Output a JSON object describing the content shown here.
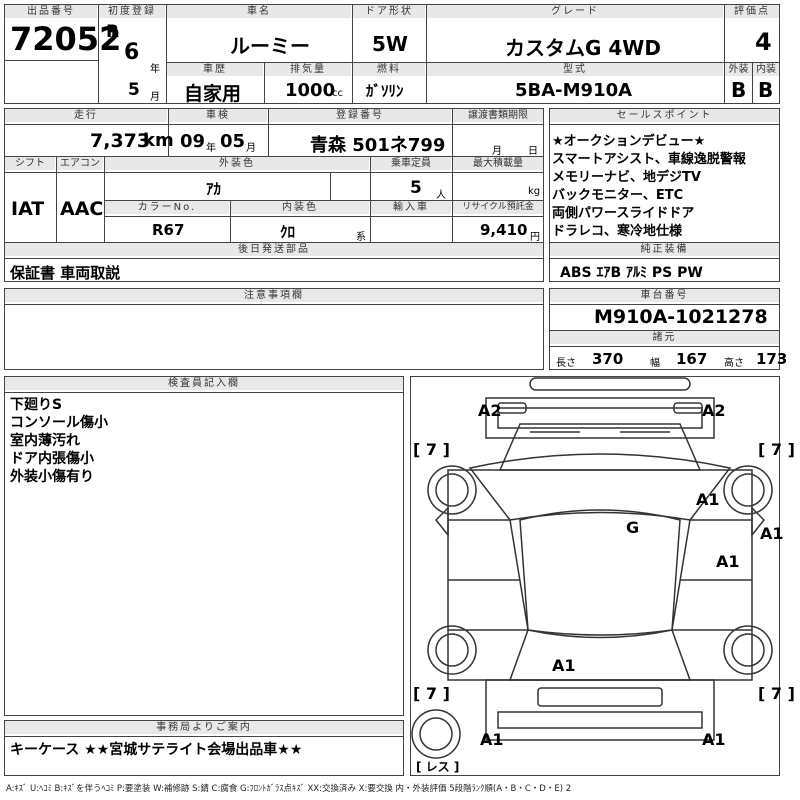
{
  "lot": {
    "label": "出品番号",
    "value": "72052"
  },
  "reg_year": {
    "label": "初度登録",
    "era": "R",
    "year": "6",
    "year_unit": "年",
    "month": "5",
    "month_unit": "月"
  },
  "car_name": {
    "label": "車名",
    "value": "ルーミー"
  },
  "door": {
    "label": "ドア形状",
    "value": "5W"
  },
  "grade": {
    "label": "グレード",
    "value": "カスタムG 4WD"
  },
  "score": {
    "label": "評価点",
    "value": "4",
    "ext_label": "外装",
    "int_label": "内装",
    "ext_value": "B",
    "int_value": "B"
  },
  "history": {
    "label": "車歴",
    "value": "自家用"
  },
  "displacement": {
    "label": "排気量",
    "value": "1000",
    "unit": "cc"
  },
  "fuel": {
    "label": "燃料",
    "value": "ｶﾞｿﾘﾝ"
  },
  "model": {
    "label": "型式",
    "value": "5BA-M910A"
  },
  "mileage": {
    "label": "走行",
    "value": "7,373",
    "unit": "km"
  },
  "inspection": {
    "label": "車検",
    "year": "09",
    "year_unit": "年",
    "month": "05",
    "month_unit": "月"
  },
  "plate": {
    "label": "登録番号",
    "value": "青森 501ネ799"
  },
  "transfer": {
    "label": "譲渡書類期限",
    "month_unit": "月",
    "day_unit": "日"
  },
  "shift": {
    "label": "シフト",
    "value": "IAT"
  },
  "ac": {
    "label": "エアコン",
    "value": "AAC"
  },
  "exterior_color": {
    "label": "外装色",
    "value": "ｱｶ"
  },
  "capacity": {
    "label": "乗車定員",
    "value": "5",
    "unit": "人"
  },
  "max_load": {
    "label": "最大積載量",
    "unit": "kg"
  },
  "color_no": {
    "label": "カラーNo.",
    "value": "R67"
  },
  "interior_color": {
    "label": "内装色",
    "value": "ｸﾛ",
    "unit": "系"
  },
  "import": {
    "label": "輸入車"
  },
  "recycle": {
    "label": "リサイクル預託金",
    "value": "9,410",
    "unit": "円"
  },
  "sales_points": {
    "label": "セールスポイント",
    "items": [
      "★オークションデビュー★",
      "スマートアシスト、車線逸脱警報",
      "メモリーナビ、地デジTV",
      "バックモニター、ETC",
      "両側パワースライドドア",
      "ドラレコ、寒冷地仕様"
    ]
  },
  "later_parts": {
    "label": "後日発送部品",
    "value": "保証書 車両取説"
  },
  "equipment": {
    "label": "純正装備",
    "value": "ABS ｴｱB ｱﾙﾐ PS PW"
  },
  "notes": {
    "label": "注意事項欄"
  },
  "chassis": {
    "label": "車台番号",
    "value": "M910A-1021278"
  },
  "dims": {
    "label": "諸元",
    "length_label": "長さ",
    "length": "370",
    "width_label": "幅",
    "width": "167",
    "height_label": "高さ",
    "height": "173"
  },
  "inspector": {
    "label": "検査員記入欄",
    "lines": [
      "下廻りS",
      "コンソール傷小",
      "室内薄汚れ",
      "ドア内張傷小",
      "外装小傷有り"
    ]
  },
  "diagram": {
    "marks": {
      "a2_left": "A2",
      "a2_right": "A2",
      "tire_tl": "[ 7 ]",
      "tire_tr": "[ 7 ]",
      "tire_bl": "[ 7 ]",
      "tire_br": "[ 7 ]",
      "roof": "G",
      "a1_fender": "A1",
      "a1_side": "A1",
      "a1_door": "A1",
      "a1_rear": "A1",
      "a1_bl": "A1",
      "a1_br": "A1",
      "spare": "[ レス ]"
    }
  },
  "office": {
    "label": "事務局よりご案内",
    "value": "キーケース ★★宮城サテライト会場出品車★★"
  },
  "legend": "A:ｷｽﾞ U:ﾍｺﾐ B:ｷｽﾞを伴うﾍｺﾐ P:要塗装 W:補修跡 S:錆 C:腐食 G:ﾌﾛﾝﾄｶﾞﾗｽ点ｷｽﾞ XX:交換済み X:要交換 内・外装評価 5段階ﾗﾝｸ順(A・B・C・D・E) 2"
}
